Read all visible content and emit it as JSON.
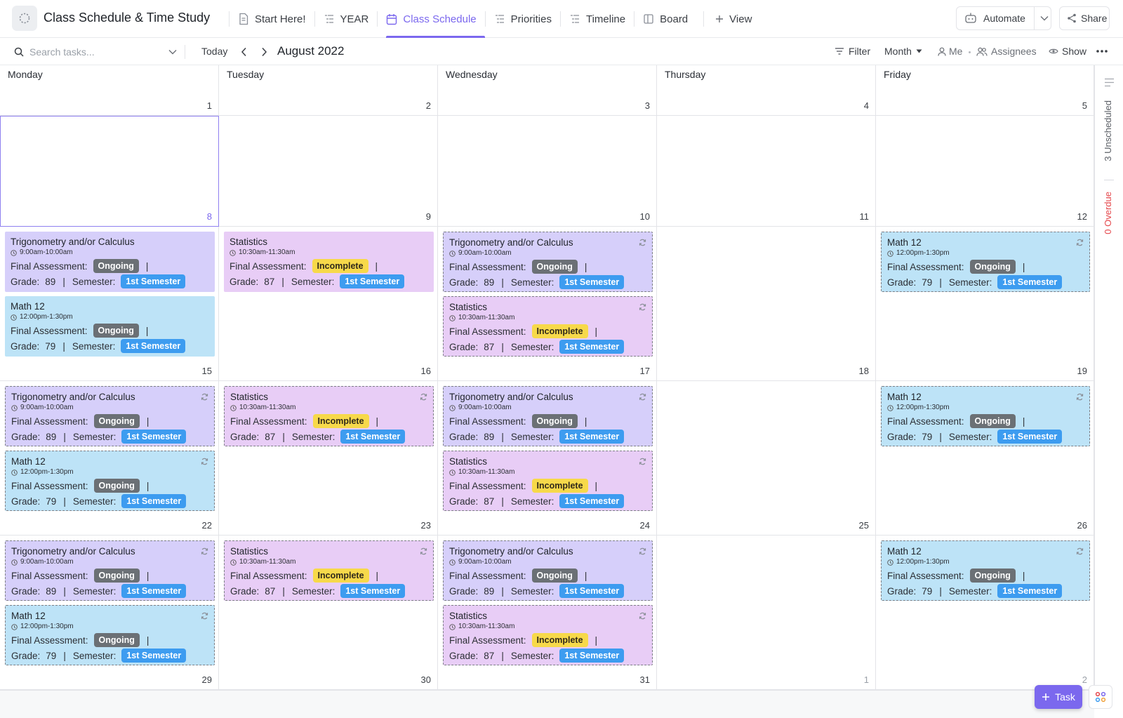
{
  "header": {
    "title": "Class Schedule & Time Study",
    "tabs": [
      {
        "label": "Start Here!",
        "icon": "doc-icon",
        "active": false
      },
      {
        "label": "YEAR",
        "icon": "list-icon",
        "active": false
      },
      {
        "label": "Class Schedule",
        "icon": "calendar-icon",
        "active": true
      },
      {
        "label": "Priorities",
        "icon": "list-icon",
        "active": false
      },
      {
        "label": "Timeline",
        "icon": "list-icon",
        "active": false
      },
      {
        "label": "Board",
        "icon": "board-icon",
        "active": false
      }
    ],
    "add_view_label": "View",
    "automate_label": "Automate",
    "share_label": "Share"
  },
  "toolbar": {
    "search_placeholder": "Search tasks...",
    "today_label": "Today",
    "month_title": "August 2022",
    "filter_label": "Filter",
    "month_select": "Month",
    "me_label": "Me",
    "assignees_label": "Assignees",
    "show_label": "Show"
  },
  "calendar": {
    "weekdays": [
      "Monday",
      "Tuesday",
      "Wednesday",
      "Thursday",
      "Friday"
    ],
    "header_days": [
      "1",
      "2",
      "3",
      "4",
      "5"
    ],
    "weeks": [
      {
        "days": [
          "8",
          "9",
          "10",
          "11",
          "12"
        ]
      },
      {
        "days": [
          "15",
          "16",
          "17",
          "18",
          "19"
        ]
      },
      {
        "days": [
          "22",
          "23",
          "24",
          "25",
          "26"
        ]
      },
      {
        "days": [
          "29",
          "30",
          "31",
          "1",
          "2"
        ]
      }
    ]
  },
  "event_types": {
    "trig": {
      "title": "Trigonometry and/or Calculus",
      "time": "9:00am-10:00am",
      "status": "Ongoing",
      "grade": "89",
      "semester": "1st Semester"
    },
    "stat": {
      "title": "Statistics",
      "time": "10:30am-11:30am",
      "status": "Incomplete",
      "grade": "87",
      "semester": "1st Semester"
    },
    "math": {
      "title": "Math 12",
      "time": "12:00pm-1:30pm",
      "status": "Ongoing",
      "grade": "79",
      "semester": "1st Semester"
    }
  },
  "labels": {
    "final_assessment": "Final Assessment:",
    "grade": "Grade:",
    "semester": "Semester:",
    "pipe": "|"
  },
  "rail": {
    "unscheduled": "3 Unscheduled",
    "overdue": "0 Overdue"
  },
  "task_button_label": "Task",
  "colors": {
    "accent": "#7b68ee",
    "trig_bg": "#d6cffa",
    "stat_bg": "#e8cdf6",
    "math_bg": "#bde3f7",
    "ongoing_badge": "#6b7075",
    "incomplete_badge": "#f7d94a",
    "semester_badge": "#3d9cf0",
    "overdue_text": "#e5484d"
  }
}
